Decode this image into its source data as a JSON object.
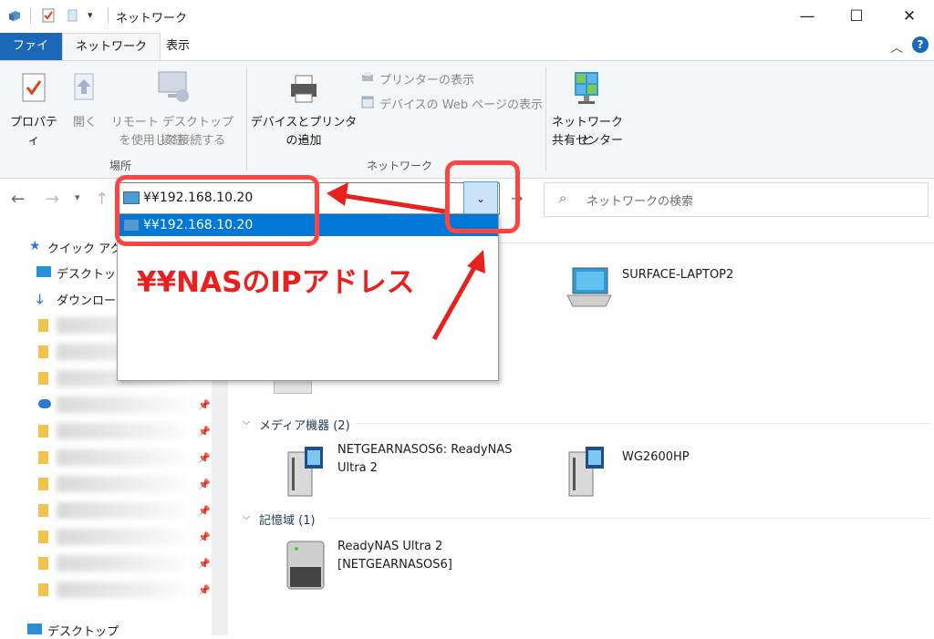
{
  "window": {
    "title": "ネットワーク",
    "minimize": "—",
    "maximize": "☐",
    "close": "✕"
  },
  "tabs": {
    "file": "ファイル",
    "network": "ネットワーク",
    "view": "表示"
  },
  "ribbon": {
    "properties": "プロパティ",
    "open": "開く",
    "remote_line1": "リモート デスクトップ接続",
    "remote_line2": "を使用して接続する",
    "group_place": "場所",
    "add_devices_line1": "デバイスとプリンター",
    "add_devices_line2": "の追加",
    "printer_view": "プリンターの表示",
    "device_web": "デバイスの Web ページの表示",
    "group_network": "ネットワーク",
    "center_line1": "ネットワークと",
    "center_line2": "共有センター"
  },
  "address": {
    "value": "¥¥192.168.10.20",
    "suggestion": "¥¥192.168.10.20",
    "search_placeholder": "ネットワークの検索"
  },
  "sidebar": {
    "quick_access": "クイック アク",
    "desktop": "デスクトップ",
    "download": "ダウンロード",
    "desktop_bottom": "デスクトップ"
  },
  "main": {
    "computer": "SURFACE-LAPTOP2",
    "media_group": "メディア機器 (2)",
    "media_1_line1": "NETGEARNASOS6: ReadyNAS",
    "media_1_line2": "Ultra 2",
    "media_2": "WG2600HP",
    "storage_group": "記憶域 (1)",
    "storage_1_line1": "ReadyNAS Ultra 2",
    "storage_1_line2": "[NETGEARNASOS6]"
  },
  "annotation": {
    "text": "¥¥NASのIPアドレス"
  },
  "colors": {
    "accent": "#0078d7",
    "file_tab": "#1c68b8",
    "annotation_red": "#e8201e"
  }
}
